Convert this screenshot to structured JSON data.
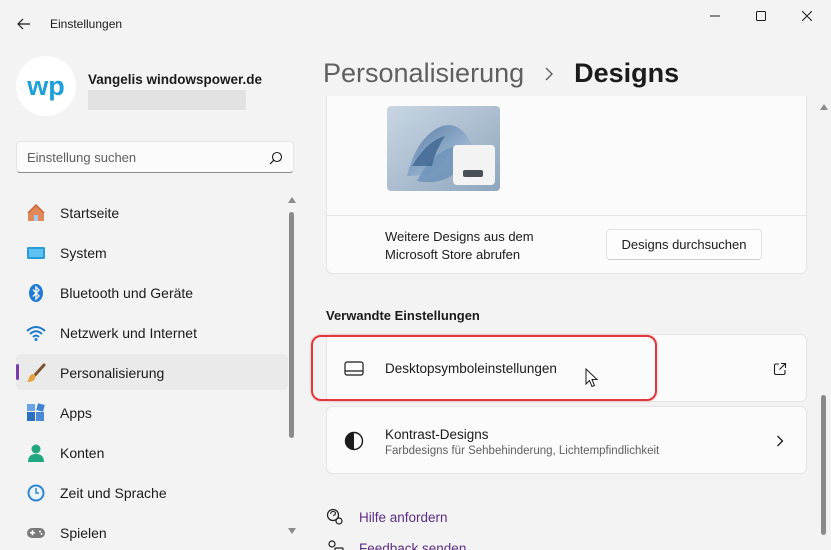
{
  "window": {
    "title": "Einstellungen",
    "controls": [
      "minimize-icon",
      "maximize-icon",
      "close-icon"
    ]
  },
  "profile": {
    "avatar_text": "wp",
    "name": "Vangelis windowspower.de"
  },
  "search": {
    "placeholder": "Einstellung suchen"
  },
  "sidebar": {
    "items": [
      {
        "label": "Startseite",
        "icon": "home-icon"
      },
      {
        "label": "System",
        "icon": "system-icon"
      },
      {
        "label": "Bluetooth und Geräte",
        "icon": "bluetooth-icon"
      },
      {
        "label": "Netzwerk und Internet",
        "icon": "wifi-icon"
      },
      {
        "label": "Personalisierung",
        "icon": "brush-icon",
        "active": true
      },
      {
        "label": "Apps",
        "icon": "apps-icon"
      },
      {
        "label": "Konten",
        "icon": "account-icon"
      },
      {
        "label": "Zeit und Sprache",
        "icon": "clock-icon"
      },
      {
        "label": "Spielen",
        "icon": "gamepad-icon"
      }
    ]
  },
  "breadcrumb": {
    "parent": "Personalisierung",
    "current": "Designs"
  },
  "themes_card": {
    "store_text": "Weitere Designs aus dem Microsoft Store abrufen",
    "browse_button": "Designs durchsuchen"
  },
  "related": {
    "title": "Verwandte Einstellungen",
    "desktop_icons": {
      "label": "Desktopsymboleinstellungen",
      "icon": "monitor-icon",
      "end_icon": "external-link-icon"
    },
    "contrast": {
      "label": "Kontrast-Designs",
      "sublabel": "Farbdesigns für Sehbehinderung, Lichtempfindlichkeit",
      "icon": "contrast-icon",
      "end_icon": "chevron-right-icon"
    }
  },
  "links": {
    "help": "Hilfe anfordern",
    "feedback": "Feedback senden"
  },
  "colors": {
    "accent": "#7a3ea8",
    "highlight": "#e0383d",
    "link": "#5b2d86"
  }
}
